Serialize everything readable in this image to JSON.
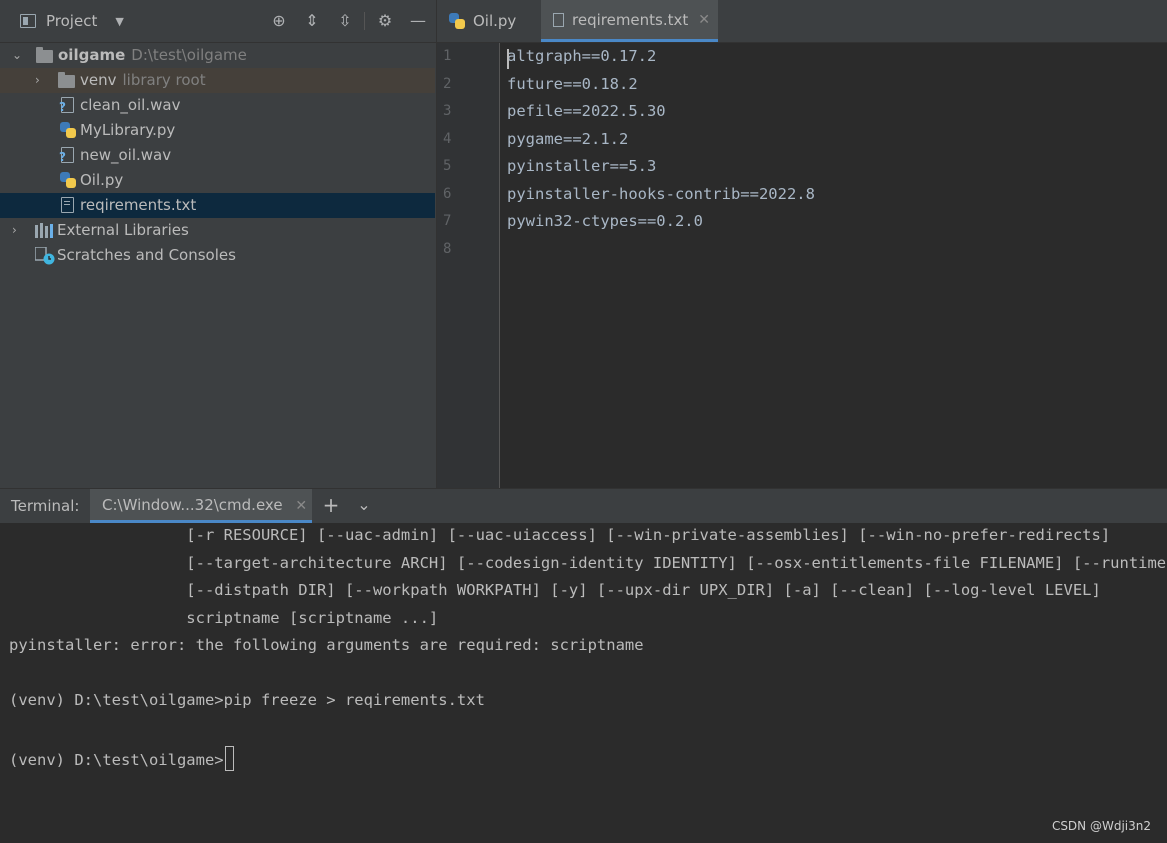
{
  "project_panel": {
    "title": "Project",
    "tree": {
      "root": {
        "name": "oilgame",
        "path": "D:\\test\\oilgame"
      },
      "venv": {
        "name": "venv",
        "hint": "library root"
      },
      "files": [
        "clean_oil.wav",
        "MyLibrary.py",
        "new_oil.wav",
        "Oil.py",
        "reqirements.txt"
      ],
      "external_libraries": "External Libraries",
      "scratches": "Scratches and Consoles"
    }
  },
  "editor": {
    "tabs": [
      {
        "label": "Oil.py",
        "active": false
      },
      {
        "label": "reqirements.txt",
        "active": true
      }
    ],
    "line_numbers": [
      "1",
      "2",
      "3",
      "4",
      "5",
      "6",
      "7",
      "8"
    ],
    "lines": [
      "altgraph==0.17.2",
      "future==0.18.2",
      "pefile==2022.5.30",
      "pygame==2.1.2",
      "pyinstaller==5.3",
      "pyinstaller-hooks-contrib==2022.8",
      "pywin32-ctypes==0.2.0",
      ""
    ]
  },
  "terminal": {
    "label": "Terminal:",
    "tab": "C:\\Window...32\\cmd.exe",
    "lines": [
      "                   [-r RESOURCE] [--uac-admin] [--uac-uiaccess] [--win-private-assemblies] [--win-no-prefer-redirects]",
      "                   [--target-architecture ARCH] [--codesign-identity IDENTITY] [--osx-entitlements-file FILENAME] [--runtime-tmpdir PATH]",
      "                   [--distpath DIR] [--workpath WORKPATH] [-y] [--upx-dir UPX_DIR] [-a] [--clean] [--log-level LEVEL]",
      "                   scriptname [scriptname ...]",
      "pyinstaller: error: the following arguments are required: scriptname",
      "",
      "(venv) D:\\test\\oilgame>pip freeze > reqirements.txt",
      "",
      "(venv) D:\\test\\oilgame>"
    ]
  },
  "watermark": "CSDN @Wdji3n2",
  "colors": {
    "accent": "#4a88c7",
    "selection": "#0d293e",
    "background": "#2b2b2b",
    "panel": "#3c3f41"
  }
}
